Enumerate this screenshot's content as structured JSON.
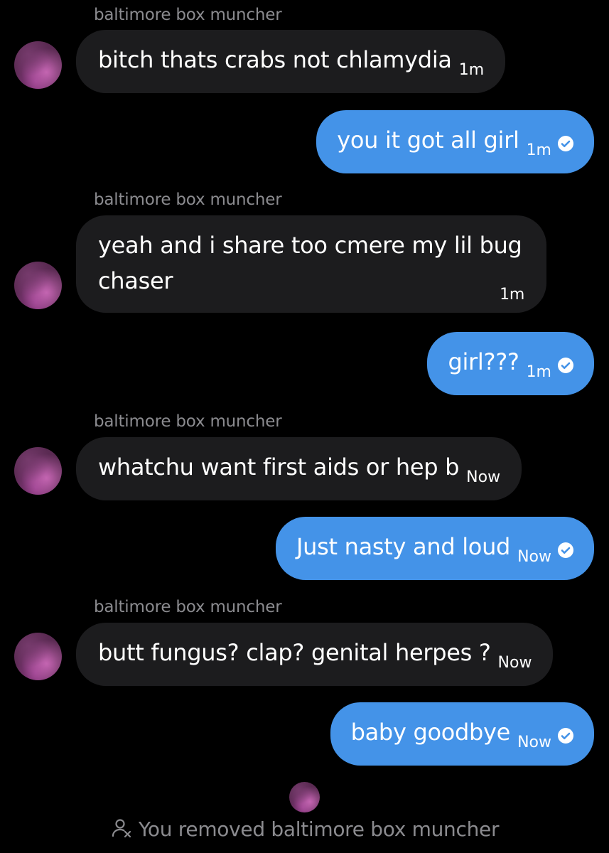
{
  "conversation": {
    "messages": [
      {
        "sender_label": "baltimore box muncher",
        "text": "bitch thats crabs not chlamydia",
        "time": "1m",
        "direction": "incoming"
      },
      {
        "text": "you it got all girl",
        "time": "1m",
        "direction": "outgoing",
        "status_icon": "check-circle-icon"
      },
      {
        "sender_label": "baltimore box muncher",
        "text": "yeah and i share too cmere my lil bug chaser",
        "time": "1m",
        "direction": "incoming"
      },
      {
        "text": "girl???",
        "time": "1m",
        "direction": "outgoing",
        "status_icon": "check-circle-icon"
      },
      {
        "sender_label": "baltimore box muncher",
        "text": "whatchu want first aids or hep b",
        "time": "Now",
        "direction": "incoming"
      },
      {
        "text": "Just nasty and loud",
        "time": "Now",
        "direction": "outgoing",
        "status_icon": "check-circle-icon"
      },
      {
        "sender_label": "baltimore box muncher",
        "text": "butt fungus? clap? genital herpes ?",
        "time": "Now",
        "direction": "incoming"
      },
      {
        "text": "baby goodbye",
        "time": "Now",
        "direction": "outgoing",
        "status_icon": "check-circle-icon"
      }
    ],
    "system_notice": {
      "icon": "person-remove-icon",
      "text": "You removed baltimore box muncher"
    }
  },
  "colors": {
    "background": "#000000",
    "incoming_bubble": "#1c1c1e",
    "outgoing_bubble": "#4493e8",
    "secondary_text": "#8b8b8f"
  }
}
